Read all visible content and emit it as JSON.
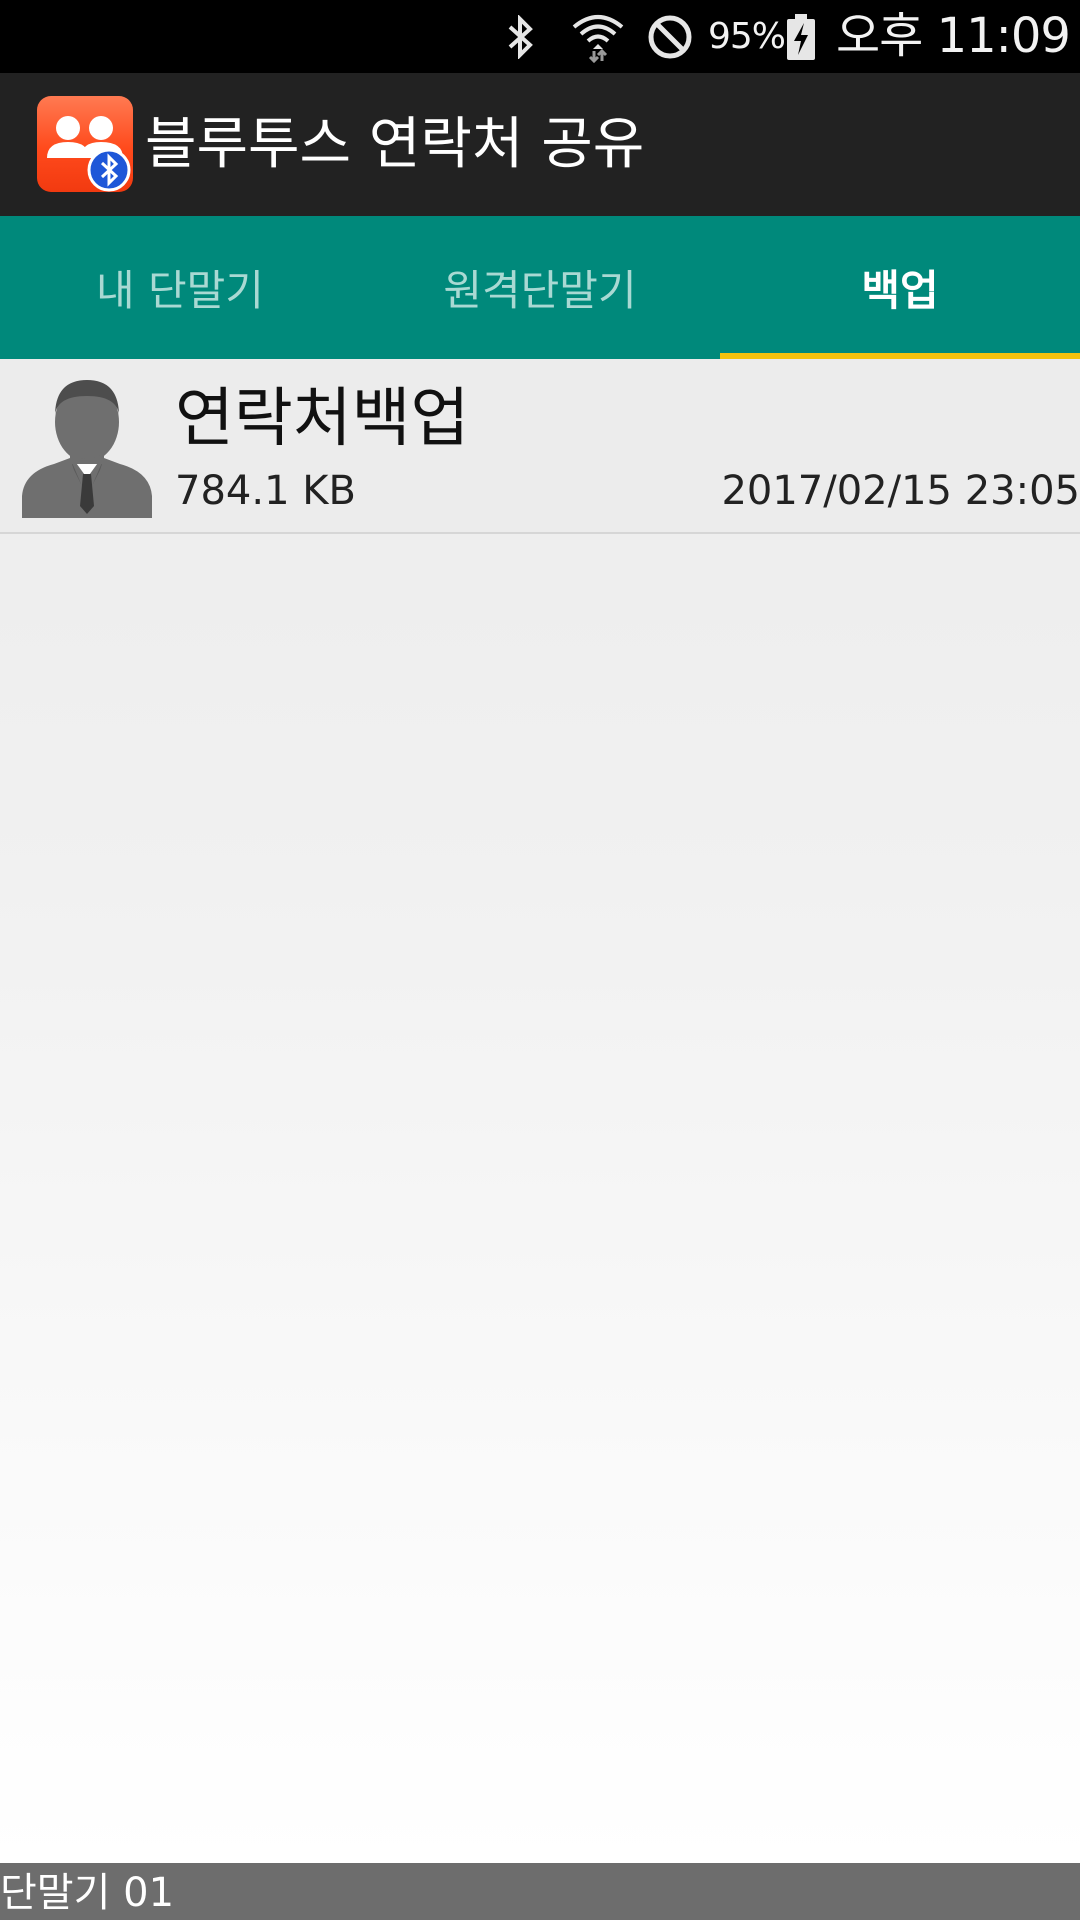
{
  "status_bar": {
    "battery_percent": "95%",
    "time": "오후 11:09",
    "icons": [
      "bluetooth-icon",
      "wifi-icon",
      "no-sim-icon",
      "battery-charging-icon"
    ]
  },
  "app_bar": {
    "title": "블루투스 연락처 공유",
    "logo_icon": "contacts-bluetooth-icon"
  },
  "tabs": [
    {
      "label": "내 단말기",
      "selected": false
    },
    {
      "label": "원격단말기",
      "selected": false
    },
    {
      "label": "백업",
      "selected": true
    }
  ],
  "backup_list": [
    {
      "title": "연락처백업",
      "size": "784.1 KB",
      "date": "2017/02/15 23:05",
      "icon": "person-avatar-icon"
    }
  ],
  "footer": {
    "device_label": "단말기 01"
  },
  "colors": {
    "status_bar_bg": "#000000",
    "app_bar_bg": "#222222",
    "tab_bg": "#00897b",
    "tab_indicator": "#f4c20d",
    "logo_orange": "#ff4a1c",
    "footer_bg": "#6d6d6d"
  }
}
